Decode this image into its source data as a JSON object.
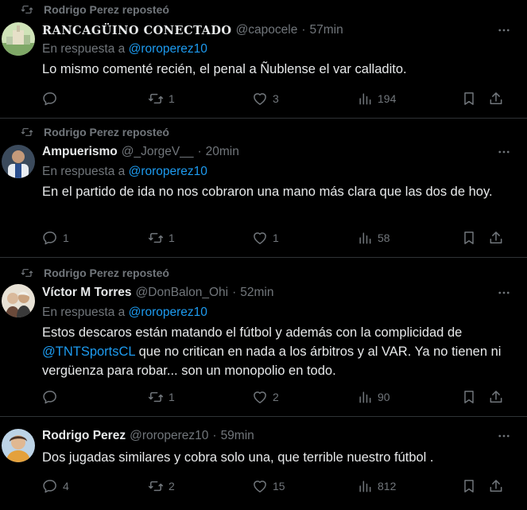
{
  "posts": [
    {
      "repost_label": "Rodrigo  Perez reposteó",
      "name": "RANCAGÜINO CONECTADO",
      "handle": "@capocele",
      "time": "57min",
      "reply_prefix": "En respuesta a",
      "reply_to": "@roroperez10",
      "text": "Lo mismo comenté recién, el penal a Ñublense el var calladito.",
      "replies": "",
      "reposts": "1",
      "likes": "3",
      "views": "194"
    },
    {
      "repost_label": "Rodrigo  Perez reposteó",
      "name": "Ampuerismo",
      "handle": "@_JorgeV__",
      "time": "20min",
      "reply_prefix": "En respuesta a",
      "reply_to": "@roroperez10",
      "text": "En el partido de ida no nos cobraron una mano más clara que las dos de hoy.",
      "replies": "1",
      "reposts": "1",
      "likes": "1",
      "views": "58"
    },
    {
      "repost_label": "Rodrigo  Perez reposteó",
      "name": "Víctor M Torres",
      "handle": "@DonBalon_Ohi",
      "time": "52min",
      "reply_prefix": "En respuesta a",
      "reply_to": "@roroperez10",
      "text_before": "Estos descaros están matando el fútbol y además con la complicidad de",
      "text_mention": "@TNTSportsCL",
      "text_after": "que no critican en nada a los árbitros y al VAR. Ya no tienen ni vergüenza para robar... son un monopolio en todo.",
      "replies": "",
      "reposts": "1",
      "likes": "2",
      "views": "90"
    },
    {
      "name": "Rodrigo Perez",
      "handle": "@roroperez10",
      "time": "59min",
      "text": "Dos jugadas similares y cobra solo una, que terrible nuestro fútbol .",
      "replies": "4",
      "reposts": "2",
      "likes": "15",
      "views": "812"
    }
  ],
  "separator": "·",
  "icons": [
    "repost-icon",
    "more-icon",
    "reply-icon",
    "like-icon",
    "views-icon",
    "bookmark-icon",
    "share-icon"
  ],
  "colors": {
    "background": "#000000",
    "text": "#e7e9ea",
    "muted": "#71767b",
    "link": "#1d9bf0",
    "divider": "#2f3336"
  }
}
